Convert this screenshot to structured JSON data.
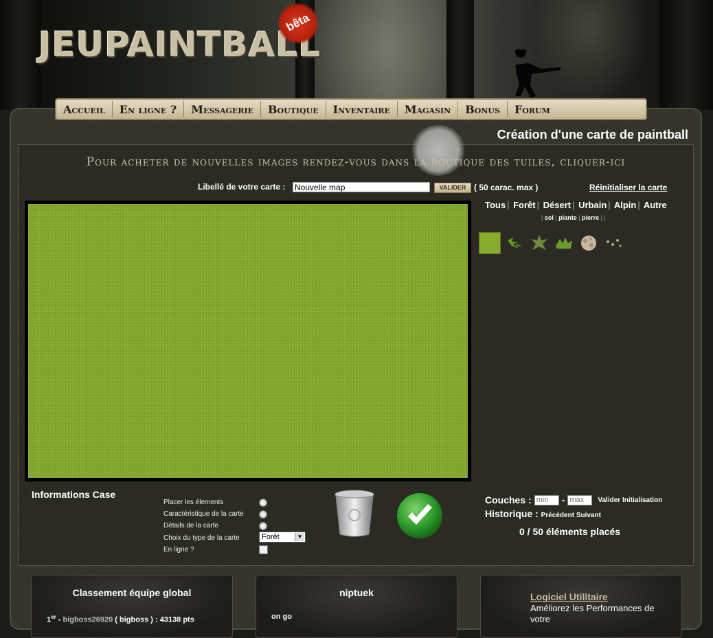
{
  "header": {
    "logo_text": "JEUPAINTBALL",
    "badge": "bêta"
  },
  "nav": {
    "items": [
      "Accueil",
      "En ligne ?",
      "Messagerie",
      "Boutique",
      "Inventaire",
      "Magasin",
      "Bonus",
      "Forum"
    ]
  },
  "page": {
    "title": "Création d'une carte de paintball",
    "shop_notice": "Pour acheter de nouvelles images rendez-vous dans la boutique des tuiles, cliquer-ici"
  },
  "map_form": {
    "label": "Libellé de votre carte :",
    "name_value": "Nouvelle map",
    "validate_label": "VALIDER",
    "max_note": "( 50 carac. max )",
    "reset_label": "Réinitialiser la carte"
  },
  "categories": {
    "main": [
      "Tous",
      "Forêt",
      "Désert",
      "Urbain",
      "Alpin",
      "Autre"
    ],
    "sub": [
      "sol",
      "plante",
      "pierre"
    ],
    "tiles": [
      "grass-tile",
      "leaf-tile",
      "fern-tile",
      "bush-tile",
      "shrub-tile",
      "rock-tile",
      "gravel-tile"
    ]
  },
  "info": {
    "title": "Informations Case",
    "options": [
      {
        "label": "Placer les élements",
        "control": "radio"
      },
      {
        "label": "Caractéristique de la carte",
        "control": "radio"
      },
      {
        "label": "Détails de la carte",
        "control": "radio"
      },
      {
        "label": "Choix du type de la carte",
        "control": "select"
      },
      {
        "label": "En ligne ?",
        "control": "checkbox"
      }
    ],
    "type_value": "Forêt"
  },
  "layers": {
    "label": "Couches :",
    "min_placeholder": "min",
    "dash": "-",
    "max_placeholder": "max",
    "validate": "Valider",
    "init": "Initialisation"
  },
  "history": {
    "label": "Historique :",
    "prev": "Précédent",
    "next": "Suivant"
  },
  "counter": "0 / 50 éléments placés",
  "panels": {
    "ranking": {
      "title": "Classement équipe global",
      "rank_num": "1",
      "rank_sup": "er",
      "player": "bigboss26920",
      "team": "( bigboss )",
      "points": "43138 pts"
    },
    "user": {
      "title": "niptuek",
      "status": "on go"
    },
    "utility": {
      "link": "Logiciel Utilitaire",
      "text": "Améliorez les Performances de votre"
    }
  },
  "colors": {
    "grass": "#86ab2d",
    "nav_bg": "#d8cba8",
    "frame": "#2c2b23"
  }
}
